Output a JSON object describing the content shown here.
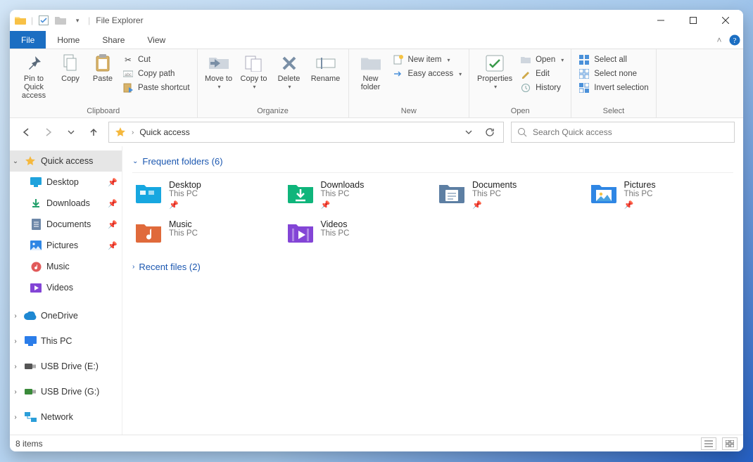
{
  "window": {
    "title": "File Explorer"
  },
  "tabs": {
    "file": "File",
    "home": "Home",
    "share": "Share",
    "view": "View"
  },
  "ribbon": {
    "clipboard": {
      "label": "Clipboard",
      "pin": "Pin to Quick access",
      "copy": "Copy",
      "paste": "Paste",
      "cut": "Cut",
      "copypath": "Copy path",
      "pasteshortcut": "Paste shortcut"
    },
    "organize": {
      "label": "Organize",
      "moveto": "Move to",
      "copyto": "Copy to",
      "delete": "Delete",
      "rename": "Rename"
    },
    "new": {
      "label": "New",
      "newfolder": "New folder",
      "newitem": "New item",
      "easyaccess": "Easy access"
    },
    "open": {
      "label": "Open",
      "properties": "Properties",
      "open": "Open",
      "edit": "Edit",
      "history": "History"
    },
    "select": {
      "label": "Select",
      "selectall": "Select all",
      "selectnone": "Select none",
      "invert": "Invert selection"
    }
  },
  "address": {
    "location": "Quick access"
  },
  "search": {
    "placeholder": "Search Quick access"
  },
  "sidebar": {
    "quickaccess": "Quick access",
    "items": [
      {
        "label": "Desktop",
        "pinned": true
      },
      {
        "label": "Downloads",
        "pinned": true
      },
      {
        "label": "Documents",
        "pinned": true
      },
      {
        "label": "Pictures",
        "pinned": true
      },
      {
        "label": "Music",
        "pinned": false
      },
      {
        "label": "Videos",
        "pinned": false
      }
    ],
    "onedrive": "OneDrive",
    "thispc": "This PC",
    "usb_e": "USB Drive (E:)",
    "usb_g": "USB Drive (G:)",
    "network": "Network"
  },
  "groups": {
    "frequent": {
      "title": "Frequent folders",
      "count": 6
    },
    "recent": {
      "title": "Recent files",
      "count": 2
    }
  },
  "folders": [
    {
      "name": "Desktop",
      "sub": "This PC",
      "pinned": true,
      "color": "#17a7e0"
    },
    {
      "name": "Downloads",
      "sub": "This PC",
      "pinned": true,
      "color": "#0fb57b"
    },
    {
      "name": "Documents",
      "sub": "This PC",
      "pinned": true,
      "color": "#5d7fa3"
    },
    {
      "name": "Pictures",
      "sub": "This PC",
      "pinned": true,
      "color": "#2f86e4"
    },
    {
      "name": "Music",
      "sub": "This PC",
      "pinned": false,
      "color": "#e06a3b"
    },
    {
      "name": "Videos",
      "sub": "This PC",
      "pinned": false,
      "color": "#8345d6"
    }
  ],
  "status": {
    "text": "8 items"
  }
}
